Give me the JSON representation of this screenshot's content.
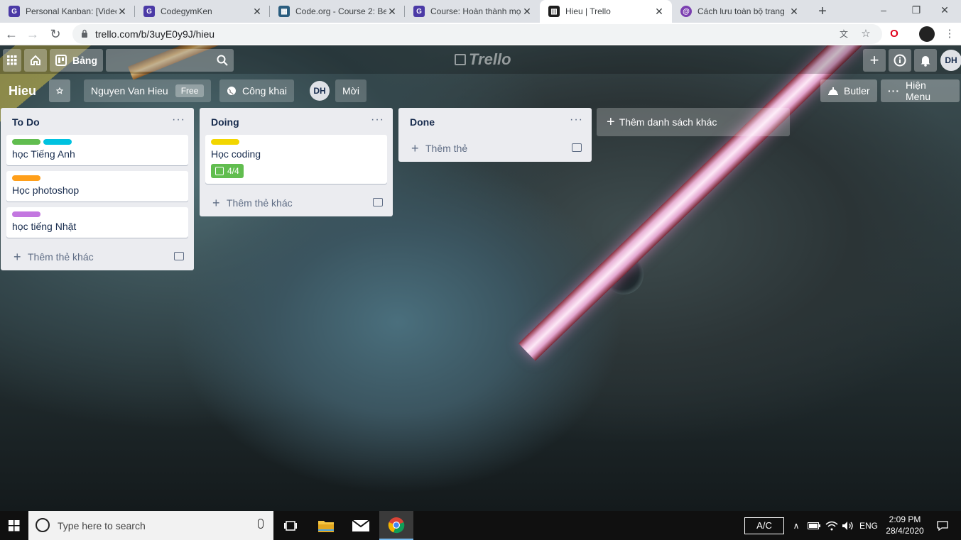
{
  "browser": {
    "tabs": [
      {
        "title": "Personal Kanban: [Video",
        "favicon": "codegym-icon",
        "color": "#4b3aa6"
      },
      {
        "title": "CodegymKen",
        "favicon": "codegym-icon",
        "color": "#4b3aa6"
      },
      {
        "title": "Code.org - Course 2: Be",
        "favicon": "codeorg-icon",
        "color": "#2a5d7f"
      },
      {
        "title": "Course: Hoàn thành mọ",
        "favicon": "codegym-icon",
        "color": "#4b3aa6"
      },
      {
        "title": "Hieu | Trello",
        "favicon": "trello-icon",
        "color": "#0079bf",
        "active": true
      },
      {
        "title": "Cách lưu toàn bộ trang",
        "favicon": "quora-icon",
        "color": "#7b3fb0"
      }
    ],
    "url": "trello.com/b/3uyE0y9J/hieu"
  },
  "header": {
    "boards_label": "Bảng",
    "logo_text": "Trello",
    "avatar_initials": "DH"
  },
  "board": {
    "title": "Hieu",
    "team_name": "Nguyen Van Hieu",
    "team_badge": "Free",
    "visibility": "Công khai",
    "member_initials": "DH",
    "invite": "Mời",
    "butler": "Butler",
    "show_menu": "Hiện Menu",
    "add_list": "Thêm danh sách khác"
  },
  "lists": [
    {
      "title": "To Do",
      "cards": [
        {
          "title": "học Tiếng Anh",
          "labels": [
            "#61bd4f",
            "#00c2e0"
          ]
        },
        {
          "title": "Học photoshop",
          "labels": [
            "#ff9f1a"
          ]
        },
        {
          "title": "học tiếng Nhật",
          "labels": [
            "#c377e0"
          ]
        }
      ],
      "add_label": "Thêm thẻ khác"
    },
    {
      "title": "Doing",
      "cards": [
        {
          "title": "Học coding",
          "labels": [
            "#f2d600"
          ],
          "checklist": "4/4"
        }
      ],
      "add_label": "Thêm thẻ khác"
    },
    {
      "title": "Done",
      "cards": [],
      "add_label": "Thêm thẻ"
    }
  ],
  "taskbar": {
    "search_placeholder": "Type here to search",
    "ac_label": "A/C",
    "lang": "ENG",
    "time": "2:09 PM",
    "date": "28/4/2020"
  }
}
